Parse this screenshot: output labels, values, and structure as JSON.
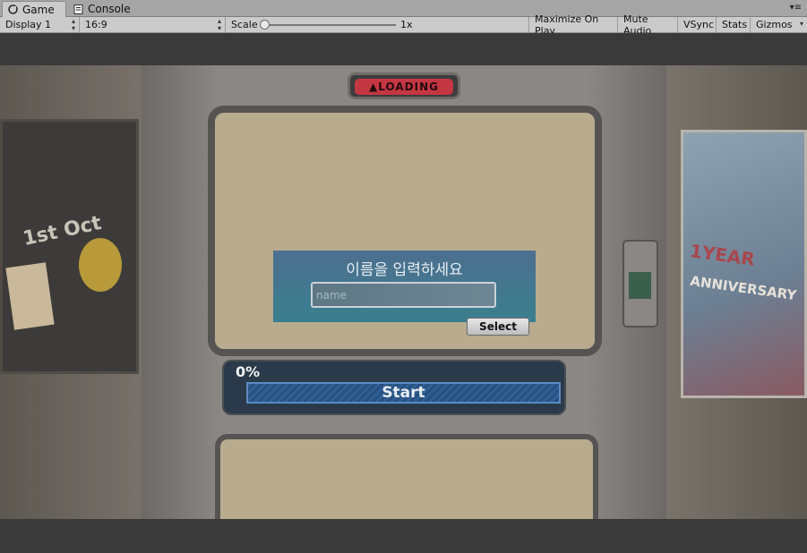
{
  "editor_tabs": {
    "game_label": "Game",
    "console_label": "Console",
    "menu_glyph": "▾≡"
  },
  "toolbar": {
    "display": "Display 1",
    "aspect": "16:9",
    "scale_label": "Scale",
    "scale_value": "1x",
    "maximize": "Maximize On Play",
    "mute": "Mute Audio",
    "vsync": "VSync",
    "stats": "Stats",
    "gizmos": "Gizmos"
  },
  "game": {
    "loading_badge": "▲LOADING",
    "poster_year": "1YEAR",
    "poster_anniversary": "ANNIVERSARY",
    "board_text": "1st Oct",
    "name_prompt": "이름을 입력하세요",
    "name_placeholder": "name",
    "select_label": "Select",
    "progress_percent": "0%",
    "start_label": "Start"
  },
  "icons": {
    "game_tab": "gamepad-icon",
    "console_tab": "console-icon"
  }
}
